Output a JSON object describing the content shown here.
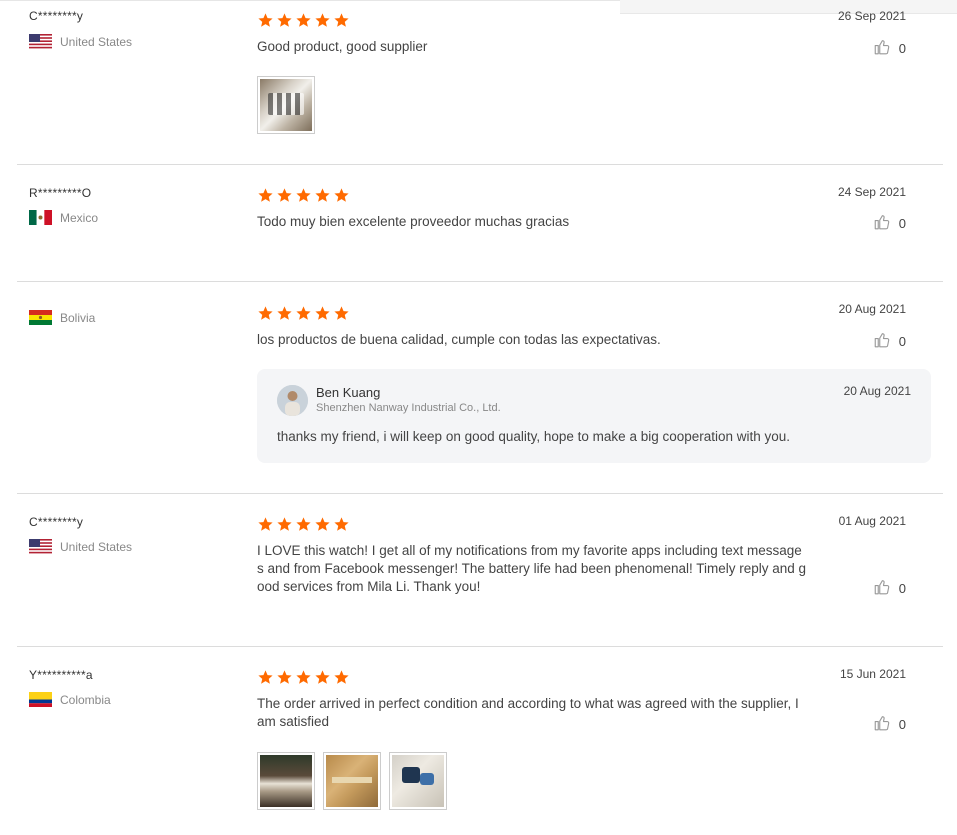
{
  "colors": {
    "star": "#ff6a00",
    "separator": "#dcdcdc",
    "reply_bg": "#f4f5f7"
  },
  "reviews": [
    {
      "user": "C********y",
      "country": "United States",
      "flag": "us-flag",
      "rating": 5,
      "date": "26 Sep 2021",
      "text": "Good product, good supplier",
      "likes": "0"
    },
    {
      "user": "R*********O",
      "country": "Mexico",
      "flag": "mexico-flag",
      "rating": 5,
      "date": "24 Sep 2021",
      "text": "Todo muy bien excelente proveedor muchas gracias",
      "likes": "0"
    },
    {
      "user": "",
      "country": "Bolivia",
      "flag": "bolivia-flag",
      "rating": 5,
      "date": "20 Aug 2021",
      "text": "los productos de buena calidad, cumple con todas las expectativas.",
      "likes": "0",
      "reply": {
        "name": "Ben Kuang",
        "company": "Shenzhen Nanway Industrial Co., Ltd.",
        "date": "20 Aug 2021",
        "text": "thanks my friend, i will keep on good quality, hope to make a big cooperation with you."
      }
    },
    {
      "user": "C********y",
      "country": "United States",
      "flag": "us-flag",
      "rating": 5,
      "date": "01 Aug 2021",
      "text_lines": [
        "I LOVE this watch! I get all of my notifications from my favorite apps including text message",
        "s and from Facebook messenger! The battery life had been phenomenal! Timely reply and g",
        "ood services from Mila Li. Thank you!"
      ],
      "likes": "0"
    },
    {
      "user": "Y**********a",
      "country": "Colombia",
      "flag": "colombia-flag",
      "rating": 5,
      "date": "15 Jun 2021",
      "text_lines": [
        "The order arrived in perfect condition and according to what was agreed with the supplier, I",
        "am satisfied"
      ],
      "likes": "0"
    }
  ]
}
